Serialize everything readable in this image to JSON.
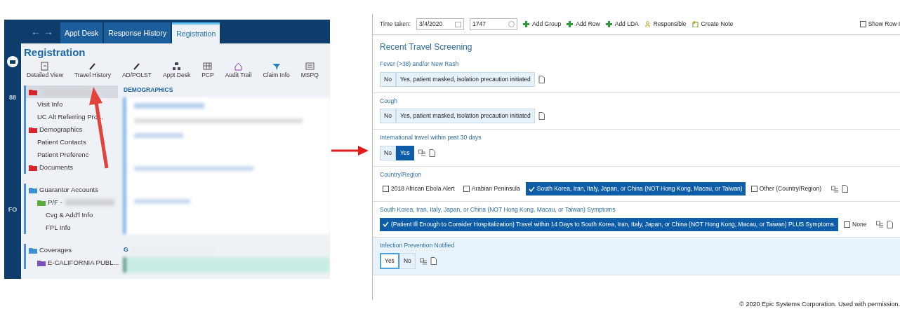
{
  "left_screen": {
    "nav_arrows": "← →",
    "tabs": [
      {
        "label": "Appt Desk",
        "selected": false
      },
      {
        "label": "Response History",
        "selected": false
      },
      {
        "label": "Registration",
        "selected": true
      }
    ],
    "side_strip_labels": [
      "88",
      "FO"
    ],
    "page_title": "Registration",
    "toolbar": [
      "Detailed View",
      "Travel History",
      "AD/POLST",
      "Appt Desk",
      "PCP",
      "Audit Trail",
      "Claim Info",
      "MSPQ"
    ],
    "tree_groups": [
      {
        "items": [
          {
            "redacted": true,
            "color": "#d9242b",
            "selected": true,
            "children": [
              {
                "label": "Visit Info",
                "selected": false
              },
              {
                "label": "UC Alt Referring Pro...",
                "selected": false
              }
            ]
          },
          {
            "label": "Demographics",
            "color": "#d9242b",
            "selected": false,
            "children": [
              {
                "label": "Patient Contacts",
                "selected": false
              },
              {
                "label": "Patient Preferenc",
                "selected": false
              }
            ]
          },
          {
            "label": "Documents",
            "color": "#d9242b",
            "selected": false
          }
        ]
      },
      {
        "items": [
          {
            "label": "Guarantor Accounts",
            "color": "#3f8fd6",
            "selected": false,
            "children": [
              {
                "label": "P/F -",
                "redacted": true,
                "color": "#5cae3c",
                "selected": false,
                "children": [
                  {
                    "label": "Cvg & Add'l Info",
                    "selected": false
                  },
                  {
                    "label": "FPL Info",
                    "selected": false
                  }
                ]
              }
            ]
          }
        ]
      },
      {
        "items": [
          {
            "label": "Coverages",
            "color": "#3f8fd6",
            "selected": false,
            "children": [
              {
                "label": "E-CALIFORNIA PUBL...",
                "color": "#7b4fc0",
                "selected": false
              }
            ]
          }
        ]
      }
    ],
    "section_header": "DEMOGRAPHICS",
    "section_2_header": "G"
  },
  "right_screen": {
    "time_label": "Time taken:",
    "date": "3/4/2020",
    "time": "1747",
    "actions": [
      {
        "label": "Add Group",
        "kind": "add"
      },
      {
        "label": "Add Row",
        "kind": "add"
      },
      {
        "label": "Add LDA",
        "kind": "add"
      },
      {
        "label": "Responsible",
        "kind": "person"
      },
      {
        "label": "Create Note",
        "kind": "note"
      }
    ],
    "show_row": {
      "label": "Show Row I",
      "checked": false
    },
    "section_title": "Recent Travel Screening",
    "questions": [
      {
        "label": "Fever (>38) and/or New Rash",
        "kind": "toggle",
        "copy_icon": false,
        "highlighted": false,
        "options": [
          {
            "label": "No",
            "selected": false
          },
          {
            "label": "Yes, patient masked, isolation precaution initiated",
            "selected": false
          }
        ]
      },
      {
        "label": "Cough",
        "kind": "toggle",
        "copy_icon": false,
        "highlighted": false,
        "options": [
          {
            "label": "No",
            "selected": false
          },
          {
            "label": "Yes, patient masked, isolation precaution initiated",
            "selected": false
          }
        ]
      },
      {
        "label": "International travel within past 30 days",
        "kind": "toggle",
        "copy_icon": true,
        "highlighted": false,
        "options": [
          {
            "label": "No",
            "selected": false
          },
          {
            "label": "Yes",
            "selected": true
          }
        ]
      },
      {
        "label": "Country/Region",
        "kind": "checks",
        "copy_icon": true,
        "highlighted": false,
        "options": [
          {
            "label": "2018 African Ebola Alert",
            "selected": false
          },
          {
            "label": "Arabian Peninsula",
            "selected": false
          },
          {
            "label": "South Korea, Iran, Italy, Japan, or China (NOT Hong Kong, Macau, or Taiwan)",
            "selected": true
          },
          {
            "label": "Other (Country/Region)",
            "selected": false
          }
        ]
      },
      {
        "label": "South Korea, Iran, Italy, Japan, or China (NOT Hong Kong, Macau, or Taiwan) Symptoms",
        "kind": "checks",
        "copy_icon": true,
        "highlighted": false,
        "options": [
          {
            "label": "(Patient Ill Enough to Consider Hospitalization) Travel within 14 Days to South Korea, Iran, Italy, Japan, or China (NOT Hong Kong, Macau, or Taiwan) PLUS Symptoms.",
            "selected": true
          },
          {
            "label": "None",
            "selected": false
          }
        ]
      },
      {
        "label": "Infection Prevention Notified",
        "kind": "toggle",
        "copy_icon": true,
        "highlighted": true,
        "options": [
          {
            "label": "Yes",
            "selected": false,
            "focused": true
          },
          {
            "label": "No",
            "selected": false,
            "focused": false
          }
        ]
      }
    ]
  },
  "copyright": "© 2020 Epic Systems Corporation. Used with permission."
}
